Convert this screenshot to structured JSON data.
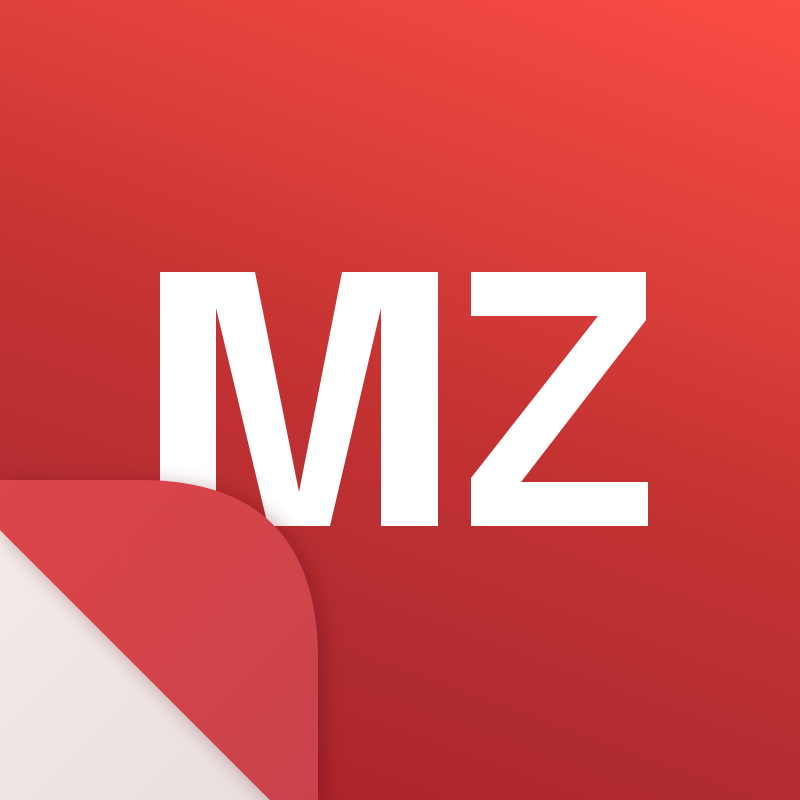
{
  "logo": {
    "text": "MZ",
    "text_color": "#ffffff",
    "background_top_color": "#fb4c44",
    "background_bottom_color": "#a92028",
    "curl_color": "#d9424a",
    "curl_underside_color": "#efe7e6"
  }
}
